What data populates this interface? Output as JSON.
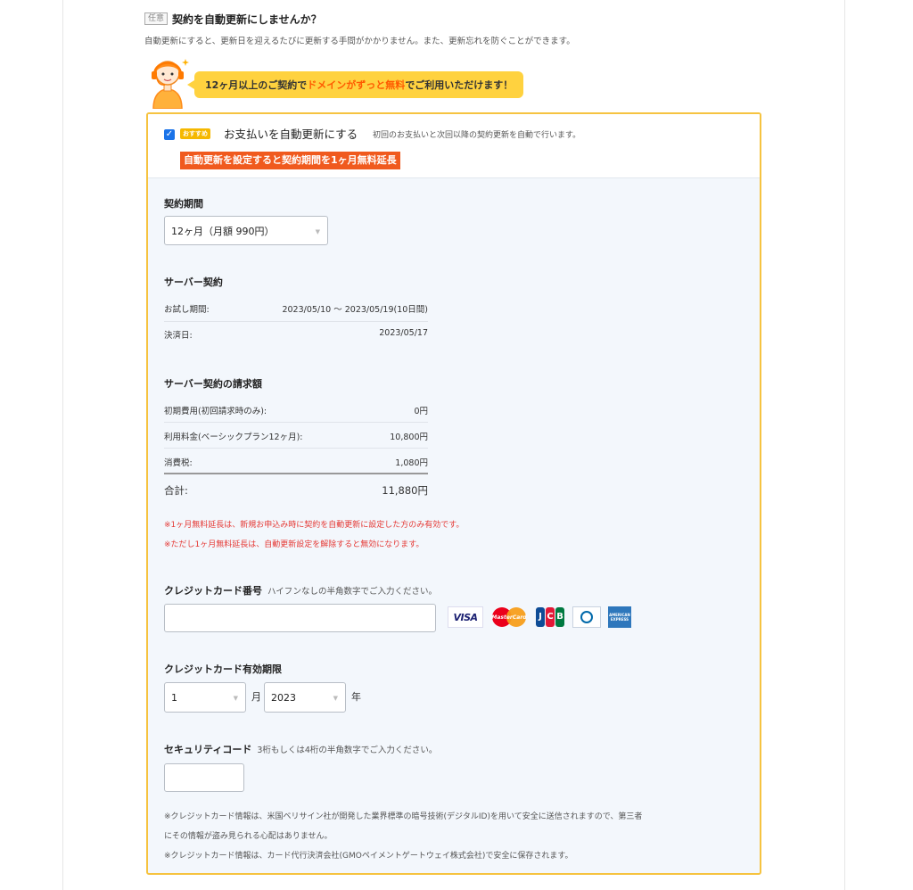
{
  "header": {
    "optional_tag": "任意",
    "title": "契約を自動更新にしませんか？",
    "description": "自動更新にすると、更新日を迎えるたびに更新する手間がかかりません。また、更新忘れを防ぐことができます。"
  },
  "promo": {
    "text_before": "12ヶ月以上のご契約で",
    "text_highlight": "ドメインがずっと無料",
    "text_after": "でご利用いただけます！"
  },
  "auto_renew": {
    "checked": true,
    "badge": "おすすめ",
    "label": "お支払いを自動更新にする",
    "note": "初回のお支払いと次回以降の契約更新を自動で行います。",
    "extension_badge": "自動更新を設定すると契約期間を1ヶ月無料延長"
  },
  "contract_period": {
    "label": "契約期間",
    "selected": "12ヶ月（月額 990円）"
  },
  "server_contract": {
    "title": "サーバー契約",
    "rows": [
      {
        "label": "お試し期間:",
        "value": "2023/05/10 〜 2023/05/19(10日間)"
      },
      {
        "label": "決済日:",
        "value": "2023/05/17"
      }
    ]
  },
  "billing": {
    "title": "サーバー契約の請求額",
    "rows": [
      {
        "label": "初期費用(初回請求時のみ):",
        "value": "0円"
      },
      {
        "label": "利用料金(ベーシックプラン12ヶ月):",
        "value": "10,800円"
      },
      {
        "label": "消費税:",
        "value": "1,080円"
      }
    ],
    "total_label": "合計:",
    "total_value": "11,880円"
  },
  "notes": [
    "※1ヶ月無料延長は、新規お申込み時に契約を自動更新に設定した方のみ有効です。",
    "※ただし1ヶ月無料延長は、自動更新設定を解除すると無効になります。"
  ],
  "card_number": {
    "label": "クレジットカード番号",
    "hint": "ハイフンなしの半角数字でご入力ください。",
    "value": "",
    "brands": [
      "VISA",
      "MasterCard",
      "JCB",
      "Diners Club",
      "American Express"
    ]
  },
  "card_expiry": {
    "label": "クレジットカード有効期限",
    "month_value": "1",
    "month_unit": "月",
    "year_value": "2023",
    "year_unit": "年"
  },
  "security_code": {
    "label": "セキュリティコード",
    "hint": "3桁もしくは4桁の半角数字でご入力ください。",
    "value": ""
  },
  "footer_notes": [
    "※クレジットカード情報は、米国ベリサイン社が開発した業界標準の暗号技術(デジタルID)を用いて安全に送信されますので、第三者",
    "にその情報が盗み見られる心配はありません。",
    "※クレジットカード情報は、カード代行決済会社(GMOペイメントゲートウェイ株式会社)で安全に保存されます。"
  ],
  "colors": {
    "accent_yellow": "#ffd23f",
    "border_yellow": "#f6c340",
    "orange": "#ff5a00",
    "red_badge": "#f05a1e",
    "note_red": "#e53935",
    "panel_bg": "#f3f7fc"
  }
}
